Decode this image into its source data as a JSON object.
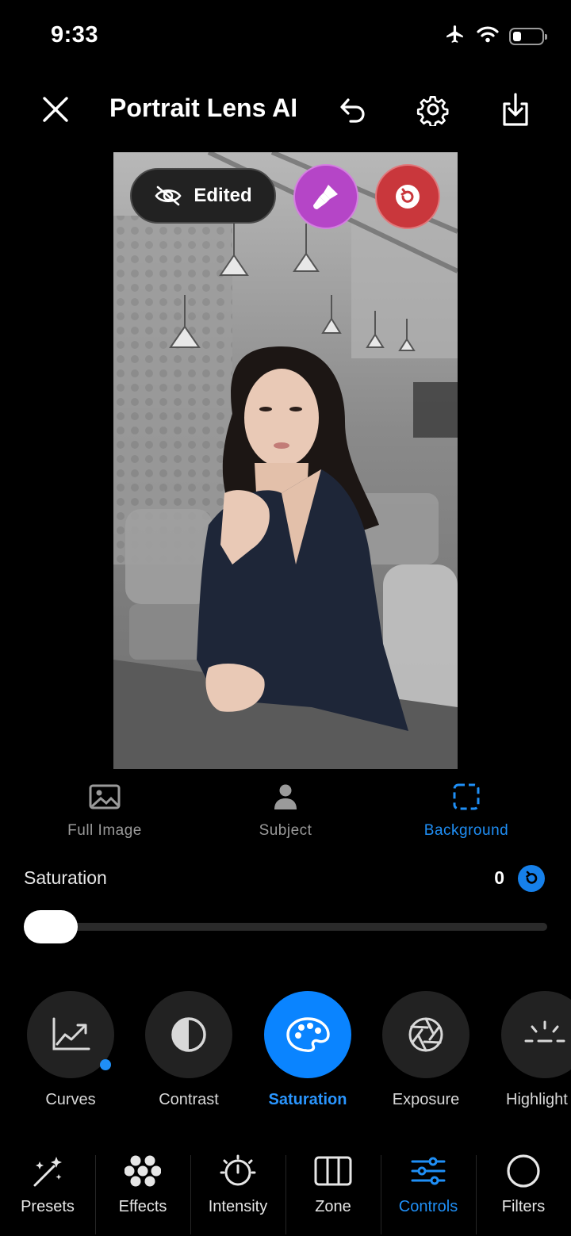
{
  "status_bar": {
    "time": "9:33",
    "icons": [
      "airplane-icon",
      "wifi-icon",
      "battery-icon"
    ],
    "battery_level": 0.3
  },
  "header": {
    "title": "Portrait Lens AI",
    "icons": [
      "close-icon",
      "undo-icon",
      "gear-icon",
      "export-icon"
    ]
  },
  "photo_overlay": {
    "edited_label": "Edited",
    "icons": [
      "eye-slash-icon",
      "brush-icon",
      "reset-icon"
    ]
  },
  "modes": [
    {
      "label": "Full Image",
      "icon": "image-icon",
      "active": false
    },
    {
      "label": "Subject",
      "icon": "person-icon",
      "active": false
    },
    {
      "label": "Background",
      "icon": "dashed-selection-icon",
      "active": true
    }
  ],
  "slider": {
    "label": "Saturation",
    "value": "0",
    "level": 0
  },
  "tools": [
    {
      "label": "Curves",
      "icon": "curves-icon",
      "active": false
    },
    {
      "label": "Contrast",
      "icon": "contrast-icon",
      "active": false
    },
    {
      "label": "Saturation",
      "icon": "palette-icon",
      "active": true
    },
    {
      "label": "Exposure",
      "icon": "aperture-icon",
      "active": false
    },
    {
      "label": "Highlight",
      "icon": "highlight-icon",
      "active": false
    }
  ],
  "bottom_nav": [
    {
      "label": "Presets",
      "icon": "sparkles-icon",
      "active": false
    },
    {
      "label": "Effects",
      "icon": "effects-icon",
      "active": false
    },
    {
      "label": "Intensity",
      "icon": "timer-icon",
      "active": false
    },
    {
      "label": "Zone",
      "icon": "columns-icon",
      "active": false
    },
    {
      "label": "Controls",
      "icon": "sliders-icon",
      "active": true
    },
    {
      "label": "Filters",
      "icon": "circle-icon",
      "active": false
    }
  ],
  "colors": {
    "accent": "#0a84ff",
    "brush_button": "#b545c7",
    "reset_button": "#c9373c",
    "background": "#000000"
  }
}
